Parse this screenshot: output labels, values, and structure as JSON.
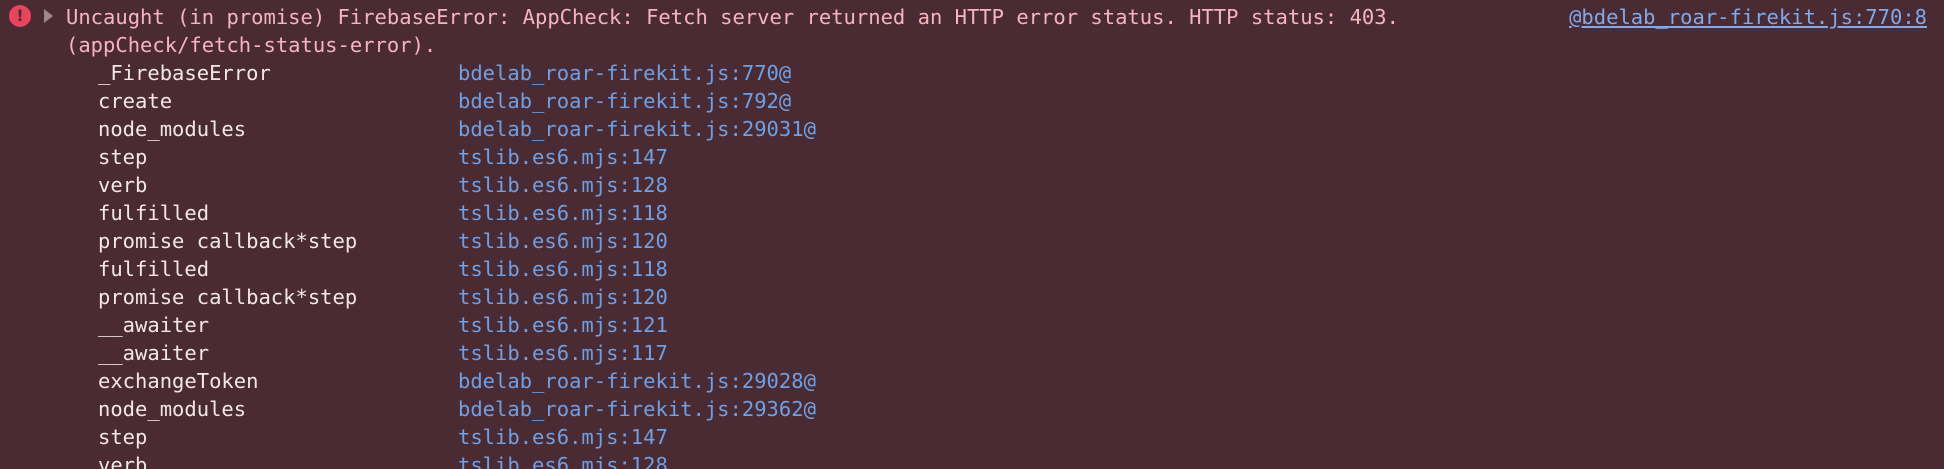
{
  "error": {
    "message_line1": "Uncaught (in promise) FirebaseError: AppCheck: Fetch server returned an HTTP error status. HTTP status: 403.",
    "message_line2": "(appCheck/fetch-status-error).",
    "source_link": "@bdelab_roar-firekit.js:770:8",
    "icon": "error-icon",
    "expand_icon": "triangle-right-icon"
  },
  "stack": [
    {
      "fn": "_FirebaseError",
      "loc": "bdelab_roar-firekit.js:770@"
    },
    {
      "fn": "create",
      "loc": "bdelab_roar-firekit.js:792@"
    },
    {
      "fn": "node_modules",
      "loc": "bdelab_roar-firekit.js:29031@"
    },
    {
      "fn": "step",
      "loc": "tslib.es6.mjs:147"
    },
    {
      "fn": "verb",
      "loc": "tslib.es6.mjs:128"
    },
    {
      "fn": "fulfilled",
      "loc": "tslib.es6.mjs:118"
    },
    {
      "fn": "promise callback*step",
      "loc": "tslib.es6.mjs:120"
    },
    {
      "fn": "fulfilled",
      "loc": "tslib.es6.mjs:118"
    },
    {
      "fn": "promise callback*step",
      "loc": "tslib.es6.mjs:120"
    },
    {
      "fn": "__awaiter",
      "loc": "tslib.es6.mjs:121"
    },
    {
      "fn": "__awaiter",
      "loc": "tslib.es6.mjs:117"
    },
    {
      "fn": "exchangeToken",
      "loc": "bdelab_roar-firekit.js:29028@"
    },
    {
      "fn": "node_modules",
      "loc": "bdelab_roar-firekit.js:29362@"
    },
    {
      "fn": "step",
      "loc": "tslib.es6.mjs:147"
    },
    {
      "fn": "verb",
      "loc": "tslib.es6.mjs:128"
    }
  ],
  "colors": {
    "background": "#4b2b33",
    "error_text": "#f6b3c0",
    "link": "#6f9fe4",
    "icon": "#e8455c"
  }
}
